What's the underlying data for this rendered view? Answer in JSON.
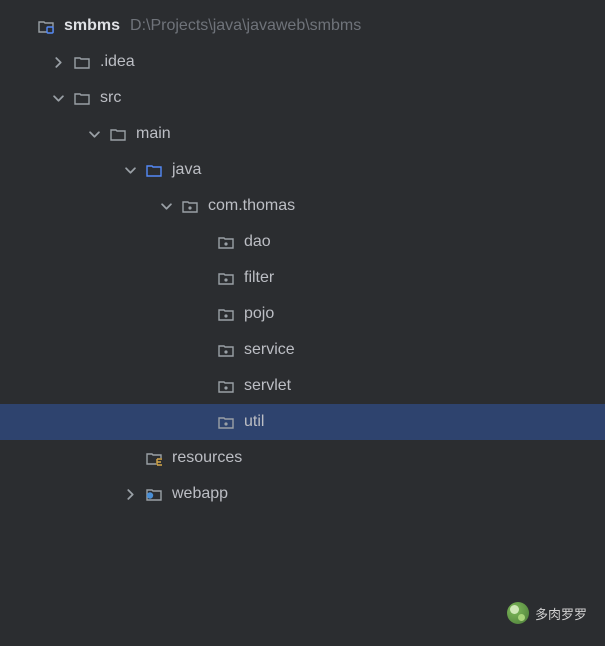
{
  "tree": {
    "root": {
      "name": "smbms",
      "path": "D:\\Projects\\java\\javaweb\\smbms",
      "expanded": true,
      "icon": "module",
      "children": [
        {
          "name": ".idea",
          "icon": "folder",
          "expanded": false,
          "hasChildren": true
        },
        {
          "name": "src",
          "icon": "folder",
          "expanded": true,
          "hasChildren": true,
          "children": [
            {
              "name": "main",
              "icon": "folder",
              "expanded": true,
              "hasChildren": true,
              "children": [
                {
                  "name": "java",
                  "icon": "source-folder",
                  "expanded": true,
                  "hasChildren": true,
                  "children": [
                    {
                      "name": "com.thomas",
                      "icon": "package",
                      "expanded": true,
                      "hasChildren": true,
                      "children": [
                        {
                          "name": "dao",
                          "icon": "package",
                          "hasChildren": false
                        },
                        {
                          "name": "filter",
                          "icon": "package",
                          "hasChildren": false
                        },
                        {
                          "name": "pojo",
                          "icon": "package",
                          "hasChildren": false
                        },
                        {
                          "name": "service",
                          "icon": "package",
                          "hasChildren": false
                        },
                        {
                          "name": "servlet",
                          "icon": "package",
                          "hasChildren": false
                        },
                        {
                          "name": "util",
                          "icon": "package",
                          "hasChildren": false,
                          "selected": true
                        }
                      ]
                    }
                  ]
                },
                {
                  "name": "resources",
                  "icon": "resources-folder",
                  "hasChildren": false
                },
                {
                  "name": "webapp",
                  "icon": "web-folder",
                  "expanded": false,
                  "hasChildren": true
                }
              ]
            }
          ]
        }
      ]
    }
  },
  "watermark": "多肉罗罗",
  "colors": {
    "bg": "#2b2d30",
    "selected": "#2e436e",
    "text": "#bcbec4",
    "muted": "#6f737a",
    "folderGray": "#9aa0a6",
    "sourceBlue": "#5a8dd6",
    "resourceYellow": "#d6b55a",
    "webCircle": "#5a8dd6"
  }
}
